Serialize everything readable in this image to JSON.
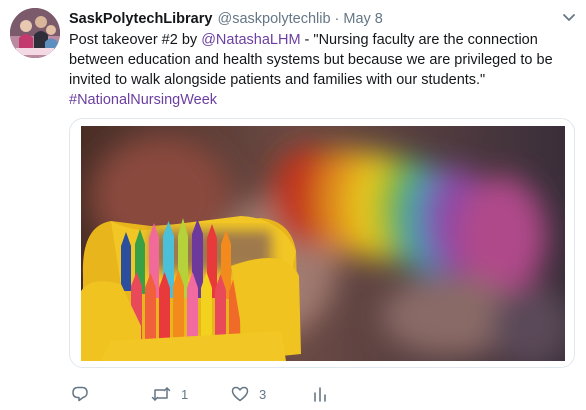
{
  "tweet": {
    "display_name": "SaskPolytechLibrary",
    "handle": "@saskpolytechlib",
    "separator": "·",
    "time": "May 8",
    "text": {
      "line1_prefix": "Post takeover #2 by ",
      "mention": "@NatashaLHM",
      "line1_suffix": " - \"Nursing faculty are the connection",
      "line2": "between education and health systems but because we are privileged to be",
      "line3": "invited to walk alongside patients and families with our students.\"",
      "hashtag": "#NationalNursingWeek"
    },
    "media": {
      "description_icon": "photo-crayons-in-box"
    },
    "actions": {
      "reply_icon": "speech-bubble-icon",
      "retweet_icon": "retweet-icon",
      "retweet_count": "1",
      "like_icon": "heart-icon",
      "like_count": "3",
      "analytics_icon": "bar-chart-icon"
    }
  },
  "colors": {
    "link": "#6b3fa0",
    "muted": "#657786",
    "text": "#14171a",
    "border": "#e1e8ed"
  }
}
